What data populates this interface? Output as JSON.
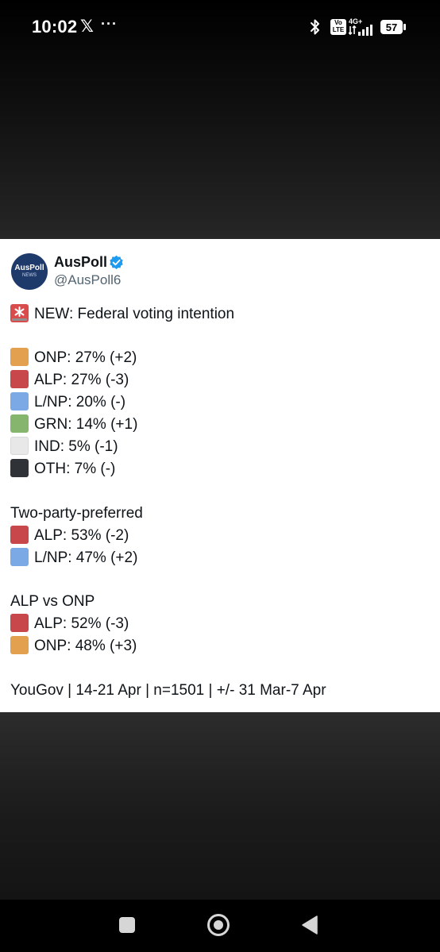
{
  "status_bar": {
    "time": "10:02",
    "x_glyph": "𝕏",
    "overflow_dots": "···",
    "volte_top": "Vo",
    "volte_bottom": "LTE",
    "network": "4G+",
    "battery": "57"
  },
  "tweet": {
    "avatar_title": "AusPoll",
    "avatar_subtitle": "NEWS",
    "display_name": "AusPoll",
    "handle": "@AusPoll6",
    "headline": "NEW: Federal voting intention",
    "primary_vote": [
      {
        "label": "ONP: 27% (+2)",
        "party": "ONP",
        "value": 27,
        "change": "+2",
        "color": "#e3a04e"
      },
      {
        "label": "ALP: 27% (-3)",
        "party": "ALP",
        "value": 27,
        "change": "-3",
        "color": "#c8474b"
      },
      {
        "label": "L/NP: 20% (-)",
        "party": "L/NP",
        "value": 20,
        "change": "-",
        "color": "#7aa9e6"
      },
      {
        "label": "GRN: 14% (+1)",
        "party": "GRN",
        "value": 14,
        "change": "+1",
        "color": "#86b56e"
      },
      {
        "label": "IND: 5% (-1)",
        "party": "IND",
        "value": 5,
        "change": "-1",
        "color": "#e8e8e8"
      },
      {
        "label": "OTH: 7% (-)",
        "party": "OTH",
        "value": 7,
        "change": "-",
        "color": "#2f3237"
      }
    ],
    "tpp_heading": "Two-party-preferred",
    "tpp": [
      {
        "label": "ALP: 53% (-2)",
        "party": "ALP",
        "value": 53,
        "change": "-2",
        "color": "#c8474b"
      },
      {
        "label": "L/NP: 47% (+2)",
        "party": "L/NP",
        "value": 47,
        "change": "+2",
        "color": "#7aa9e6"
      }
    ],
    "alp_onp_heading": "ALP vs ONP",
    "alp_onp": [
      {
        "label": "ALP: 52% (-3)",
        "party": "ALP",
        "value": 52,
        "change": "-3",
        "color": "#c8474b"
      },
      {
        "label": "ONP: 48% (+3)",
        "party": "ONP",
        "value": 48,
        "change": "+3",
        "color": "#e3a04e"
      }
    ],
    "footer": "YouGov | 14-21 Apr | n=1501 | +/- 31 Mar-7 Apr"
  },
  "icons": [
    "bluetooth-icon",
    "signal-icon",
    "battery-icon",
    "verified-icon",
    "siren-icon",
    "recents-icon",
    "home-icon",
    "back-icon"
  ]
}
